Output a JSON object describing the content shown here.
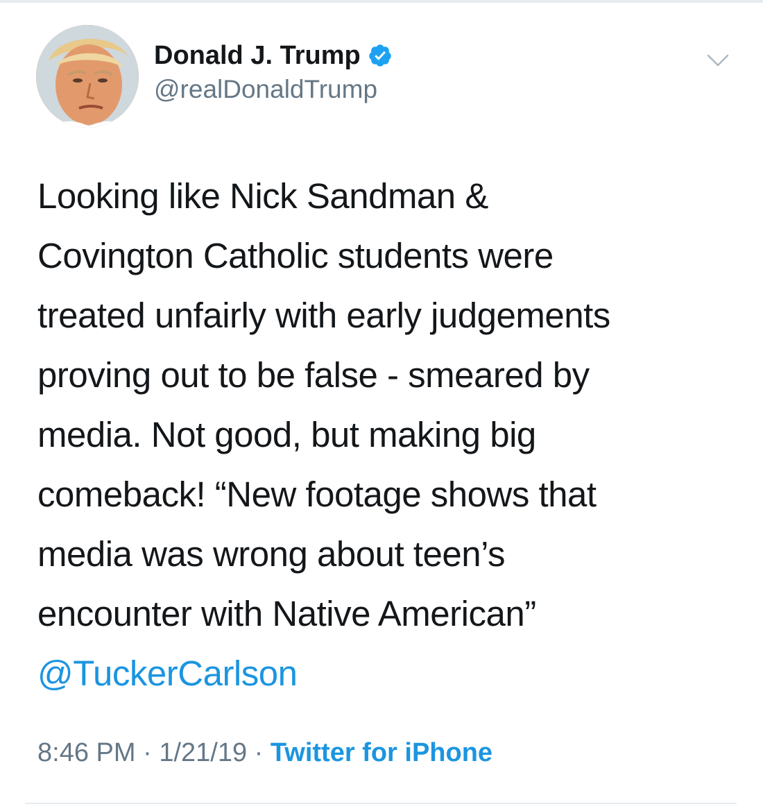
{
  "author": {
    "display_name": "Donald J. Trump",
    "handle": "@realDonaldTrump",
    "verified": true
  },
  "icons": {
    "verified": "verified-badge-icon",
    "menu": "chevron-down-icon",
    "avatar": "profile-photo"
  },
  "tweet": {
    "lines": [
      "Looking like Nick Sandman &",
      "Covington Catholic students were",
      "treated unfairly with early judgements",
      "proving out to be false - smeared by",
      "media. Not good, but making big",
      "comeback! “New footage shows that",
      "media was wrong about teen’s",
      "encounter with Native American”"
    ],
    "mention": "@TuckerCarlson"
  },
  "meta": {
    "time": "8:46 PM",
    "separator": " · ",
    "date": "1/21/19",
    "source": "Twitter for iPhone"
  },
  "colors": {
    "link": "#1b95e0",
    "secondary": "#657786",
    "text": "#14171a",
    "divider": "#e6ecf0"
  }
}
